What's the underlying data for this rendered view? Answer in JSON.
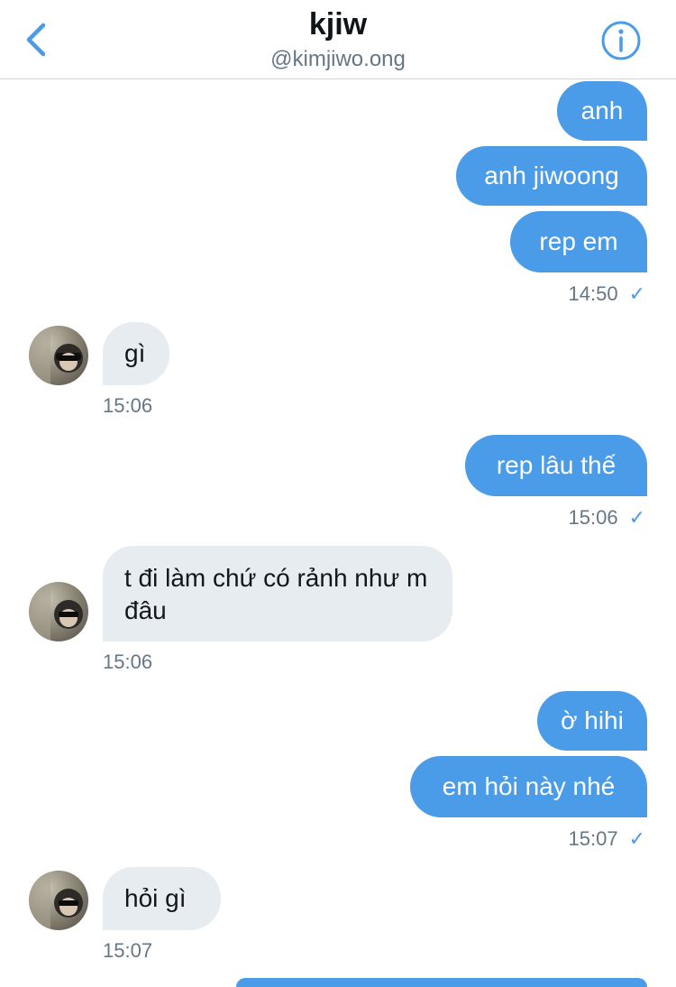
{
  "header": {
    "title": "kjiw",
    "handle": "@kimjiwo.ong",
    "back_icon": "chevron-left-icon",
    "info_icon": "info-icon",
    "accent_color": "#4a9be8"
  },
  "messages": [
    {
      "direction": "outgoing",
      "text": "anh"
    },
    {
      "direction": "outgoing",
      "text": "anh jiwoong"
    },
    {
      "direction": "outgoing",
      "text": "rep em",
      "time": "14:50",
      "read": "✓"
    },
    {
      "direction": "incoming",
      "text": "gì",
      "time": "15:06"
    },
    {
      "direction": "outgoing",
      "text": "rep lâu thế",
      "time": "15:06",
      "read": "✓"
    },
    {
      "direction": "incoming",
      "text": "t đi làm chứ có rảnh như m đâu",
      "time": "15:06"
    },
    {
      "direction": "outgoing",
      "text": "ờ hihi"
    },
    {
      "direction": "outgoing",
      "text": "em hỏi này nhé",
      "time": "15:07",
      "read": "✓"
    },
    {
      "direction": "incoming",
      "text": "hỏi gì",
      "time": "15:07"
    },
    {
      "direction": "outgoing",
      "text": ""
    }
  ]
}
